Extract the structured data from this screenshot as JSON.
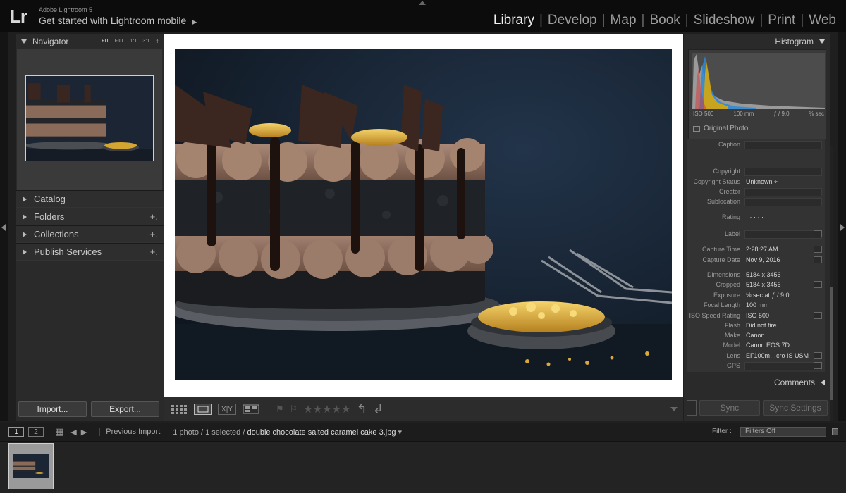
{
  "app": {
    "logo": "Lr",
    "name": "Adobe Lightroom 5",
    "promo": "Get started with Lightroom mobile"
  },
  "modules": [
    "Library",
    "Develop",
    "Map",
    "Book",
    "Slideshow",
    "Print",
    "Web"
  ],
  "active_module": "Library",
  "left_panel": {
    "navigator": {
      "title": "Navigator",
      "zoom_fit": "FIT",
      "zoom_fill": "FILL",
      "zoom_1to1": "1:1",
      "zoom_3to1": "3:1"
    },
    "sections": [
      {
        "label": "Catalog",
        "plus": ""
      },
      {
        "label": "Folders",
        "plus": "+."
      },
      {
        "label": "Collections",
        "plus": "+."
      },
      {
        "label": "Publish Services",
        "plus": "+."
      }
    ],
    "import_label": "Import...",
    "export_label": "Export..."
  },
  "toolbar": {
    "grid_view": "grid-view-icon",
    "loupe_view": "loupe-view-icon",
    "compare_label": "X|Y",
    "survey_view": "survey-view-icon",
    "stars": "★★★★★",
    "rotate_left": "↰",
    "rotate_right": "↲"
  },
  "right_panel": {
    "histogram": {
      "title": "Histogram",
      "iso": "ISO 500",
      "focal": "100 mm",
      "aperture": "ƒ / 9.0",
      "shutter": "⅛ sec",
      "original_photo": "Original Photo"
    },
    "metadata": [
      {
        "label": "Caption",
        "value": "",
        "field": true
      },
      {
        "label": "Copyright",
        "value": "",
        "field": true
      },
      {
        "label": "Copyright Status",
        "value": "Unknown ÷",
        "field": false
      },
      {
        "label": "Creator",
        "value": "",
        "field": true
      },
      {
        "label": "Sublocation",
        "value": "",
        "field": true
      },
      {
        "label": "Rating",
        "value": "·   ·   ·   ·   ·",
        "field": false
      },
      {
        "label": "Label",
        "value": "",
        "field": true
      },
      {
        "label": "Capture Time",
        "value": "2:28:27 AM",
        "field": false
      },
      {
        "label": "Capture Date",
        "value": "Nov 9, 2016",
        "field": false
      },
      {
        "label": "Dimensions",
        "value": "5184 x 3456",
        "field": false
      },
      {
        "label": "Cropped",
        "value": "5184 x 3456",
        "field": false
      },
      {
        "label": "Exposure",
        "value": "⅛ sec at ƒ / 9.0",
        "field": false
      },
      {
        "label": "Focal Length",
        "value": "100 mm",
        "field": false
      },
      {
        "label": "ISO Speed Rating",
        "value": "ISO 500",
        "field": false
      },
      {
        "label": "Flash",
        "value": "Did not fire",
        "field": false
      },
      {
        "label": "Make",
        "value": "Canon",
        "field": false
      },
      {
        "label": "Model",
        "value": "Canon EOS 7D",
        "field": false
      },
      {
        "label": "Lens",
        "value": "EF100m…cro IS USM",
        "field": false
      },
      {
        "label": "GPS",
        "value": "",
        "field": true
      }
    ],
    "comments": "Comments",
    "sync_label": "Sync",
    "sync_settings_label": "Sync Settings"
  },
  "filmstrip_bar": {
    "page1": "1",
    "page2": "2",
    "source": "Previous Import",
    "count": "1 photo / 1 selected /",
    "filename": "double chocolate salted caramel cake 3.jpg",
    "filename_arrow": "▾",
    "filter_label": "Filter :",
    "filter_value": "Filters Off"
  },
  "colors": {
    "accent": "#f2f2f2",
    "panel": "#2a2a2a",
    "background": "#1f1f1f"
  }
}
